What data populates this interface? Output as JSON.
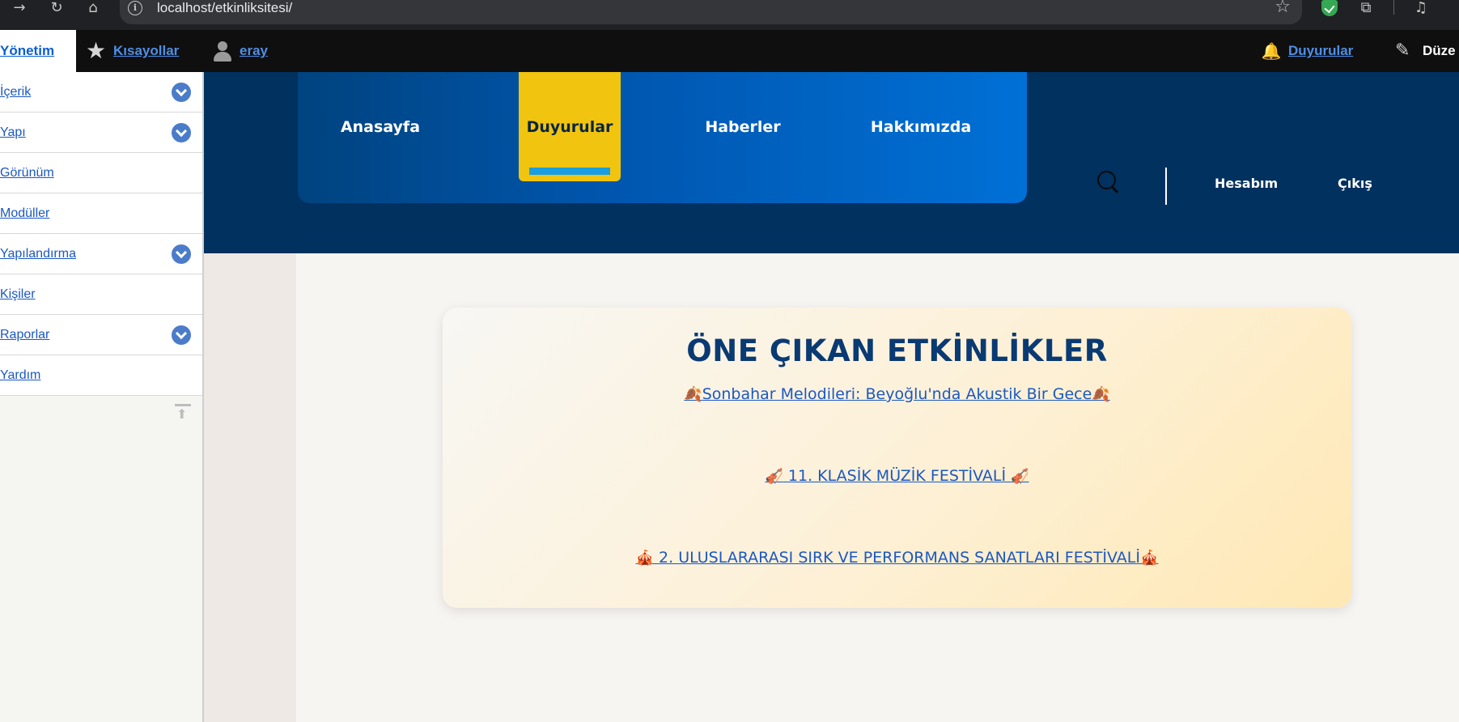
{
  "browser": {
    "url": "localhost/etkinliksitesi/",
    "icons": [
      "forward-icon",
      "reload-icon",
      "home-icon",
      "info-icon",
      "bookmark-star-icon",
      "shield-extension-icon",
      "extensions-icon",
      "media-icon"
    ]
  },
  "toolbar": {
    "manage_label": "Yönetim",
    "shortcuts_label": "Kısayollar",
    "user_label": "eray",
    "announcements_label": "Duyurular",
    "edit_label": "Düze"
  },
  "sidebar": {
    "items": [
      {
        "label": "İçerik",
        "expandable": true
      },
      {
        "label": "Yapı",
        "expandable": true
      },
      {
        "label": "Görünüm",
        "expandable": false
      },
      {
        "label": "Modüller",
        "expandable": false
      },
      {
        "label": "Yapılandırma",
        "expandable": true
      },
      {
        "label": "Kişiler",
        "expandable": false
      },
      {
        "label": "Raporlar",
        "expandable": true
      },
      {
        "label": "Yardım",
        "expandable": false
      }
    ]
  },
  "nav": {
    "items": [
      "Anasayfa",
      "Duyurular",
      "Haberler",
      "Hakkımızda"
    ],
    "active": "Duyurular",
    "account_label": "Hesabım",
    "logout_label": "Çıkış"
  },
  "featured": {
    "title": "ÖNE ÇIKAN ETKİNLİKLER",
    "events": [
      {
        "emoji": "🍂",
        "text": "Sonbahar Melodileri: Beyoğlu'nda Akustik Bir Gece"
      },
      {
        "emoji": "🎻",
        "text": " 11. KLASİK MÜZİK FESTİVALİ "
      },
      {
        "emoji": "🎪",
        "text": " 2. ULUSLARARASI SIRK VE PERFORMANS SANATLARI FESTİVALİ"
      }
    ]
  },
  "colors": {
    "header_bg": "#00315f",
    "active_tab": "#f1c40f",
    "title": "#0a3a73",
    "link": "#1b58c2"
  }
}
